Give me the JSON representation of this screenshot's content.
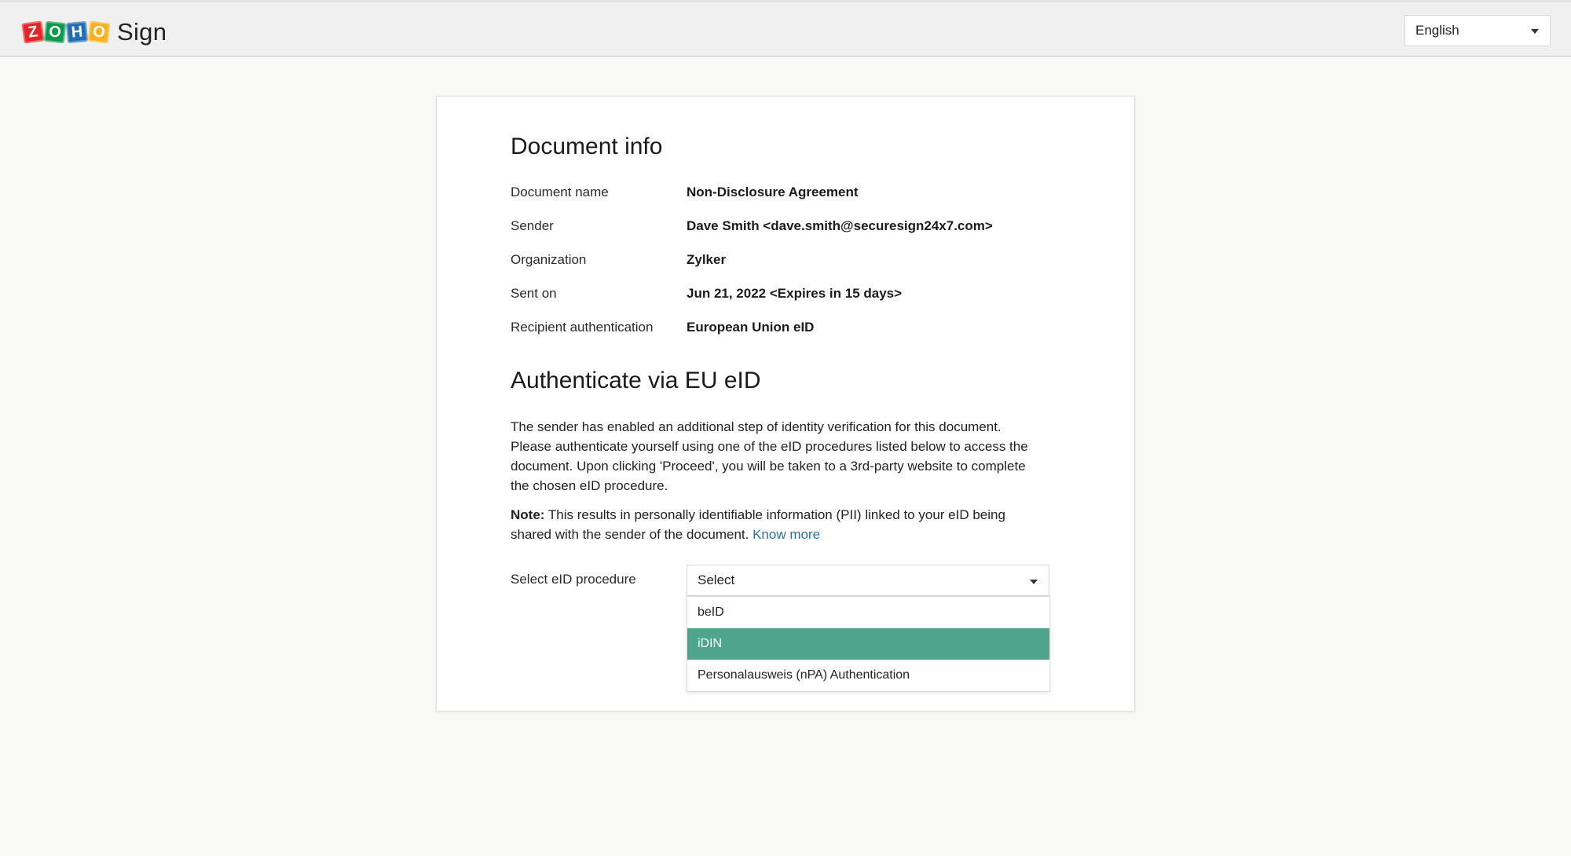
{
  "header": {
    "logo_letters": [
      "Z",
      "O",
      "H",
      "O"
    ],
    "product_name": "Sign",
    "language": "English"
  },
  "document_info": {
    "title": "Document info",
    "rows": [
      {
        "label": "Document name",
        "value": "Non-Disclosure Agreement"
      },
      {
        "label": "Sender",
        "value": "Dave Smith <dave.smith@securesign24x7.com>"
      },
      {
        "label": "Organization",
        "value": "Zylker"
      },
      {
        "label": "Sent on",
        "value": "Jun 21, 2022 <Expires in 15 days>"
      },
      {
        "label": "Recipient authentication",
        "value": "European Union eID"
      }
    ]
  },
  "authenticate": {
    "title": "Authenticate via EU eID",
    "description": "The sender has enabled an additional step of identity verification for this document. Please authenticate yourself using one of the eID procedures listed below to access the document. Upon clicking 'Proceed', you will be taken to a 3rd-party website to complete the chosen eID procedure.",
    "note_label": "Note:",
    "note_text": " This results in personally identifiable information (PII) linked to your eID being shared with the sender of the document. ",
    "know_more": "Know more",
    "select_label": "Select eID procedure",
    "select_value": "Select",
    "options": [
      "beID",
      "iDIN",
      "Personalausweis (nPA) Authentication"
    ],
    "highlighted_option": "iDIN"
  },
  "colors": {
    "highlight": "#4ea58b",
    "link": "#2f6ea8"
  }
}
